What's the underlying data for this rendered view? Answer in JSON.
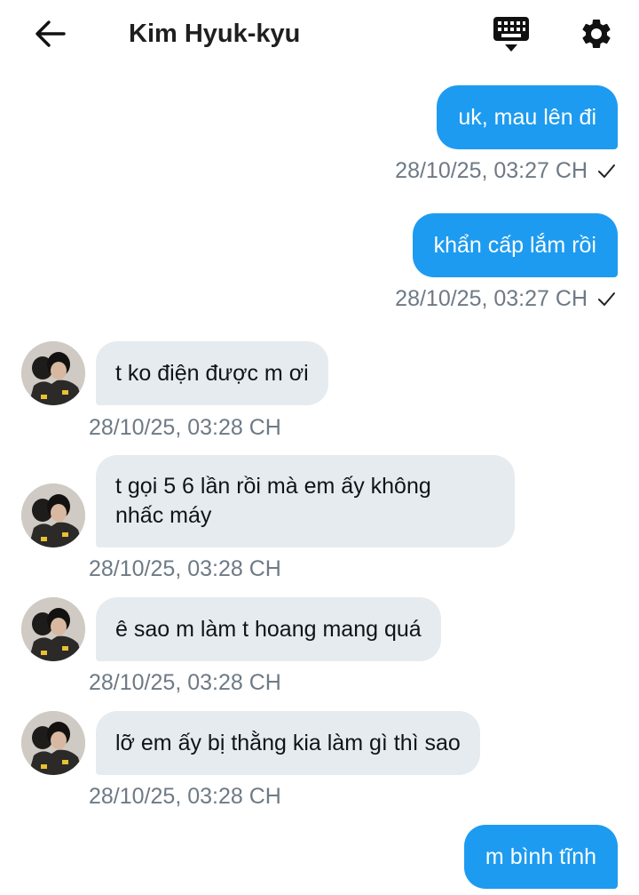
{
  "header": {
    "title": "Kim Hyuk-kyu",
    "back_icon": "back-arrow-icon",
    "keyboard_icon": "keyboard-icon",
    "settings_icon": "gear-icon"
  },
  "colors": {
    "outgoing_bubble": "#1d9bf0",
    "incoming_bubble": "#e6ebef",
    "timestamp": "#6e7a85"
  },
  "messages": [
    {
      "direction": "outgoing",
      "text": "uk, mau lên đi",
      "time": "28/10/25, 03:27 CH",
      "read": true
    },
    {
      "direction": "outgoing",
      "text": "khẩn cấp lắm rồi",
      "time": "28/10/25, 03:27 CH",
      "read": true
    },
    {
      "direction": "incoming",
      "text": "t ko điện được m ơi",
      "time": "28/10/25, 03:28 CH"
    },
    {
      "direction": "incoming",
      "lines": [
        "t gọi 5 6 lần rồi mà em ấy không",
        "nhấc máy"
      ],
      "time": "28/10/25, 03:28 CH"
    },
    {
      "direction": "incoming",
      "text": "ê sao m làm t hoang mang quá",
      "time": "28/10/25, 03:28 CH"
    },
    {
      "direction": "incoming",
      "text": "lỡ em ấy bị thằng kia làm gì thì sao",
      "time": "28/10/25, 03:28 CH"
    },
    {
      "direction": "outgoing",
      "text": "m bình tĩnh"
    }
  ]
}
